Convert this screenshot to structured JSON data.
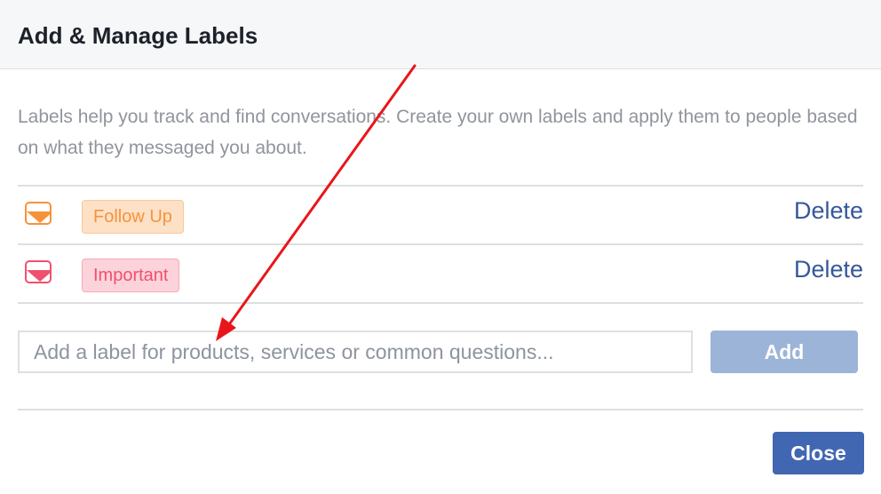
{
  "dialog": {
    "title": "Add & Manage Labels",
    "description": "Labels help you track and find conversations. Create your own labels and apply them to people based on what they messaged you about."
  },
  "labels": [
    {
      "name": "Follow Up",
      "delete_label": "Delete",
      "icon": "orange-label-dropdown-icon",
      "color": "#f7923b",
      "chip_bg": "#fde1c6",
      "chip_border": "#f9c79a",
      "chip_text": "#f7923b"
    },
    {
      "name": "Important",
      "delete_label": "Delete",
      "icon": "pink-label-dropdown-icon",
      "color": "#f0506e",
      "chip_bg": "#fcd3db",
      "chip_border": "#f7a9b8",
      "chip_text": "#f0506e"
    }
  ],
  "add_form": {
    "placeholder": "Add a label for products, services or common questions...",
    "value": "",
    "add_label": "Add"
  },
  "footer": {
    "close_label": "Close"
  },
  "colors": {
    "link": "#365899",
    "primary_button": "#4267b2",
    "disabled_button": "#9cb4d8",
    "annotation_arrow": "#e8161b"
  }
}
